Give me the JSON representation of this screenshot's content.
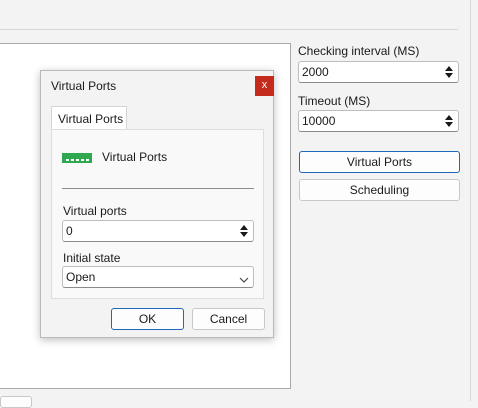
{
  "right_panel": {
    "checking_interval_label": "Checking interval (MS)",
    "checking_interval_value": "2000",
    "timeout_label": "Timeout (MS)",
    "timeout_value": "10000",
    "virtual_ports_button": "Virtual Ports",
    "scheduling_button": "Scheduling"
  },
  "dialog": {
    "title": "Virtual Ports",
    "close_label": "x",
    "tab_label": "Virtual Ports",
    "header_text": "Virtual Ports",
    "virtual_ports_label": "Virtual ports",
    "virtual_ports_value": "0",
    "initial_state_label": "Initial state",
    "initial_state_value": "Open",
    "ok_label": "OK",
    "cancel_label": "Cancel"
  },
  "colors": {
    "close_button": "#c42b1c",
    "primary_border": "#1e68b5",
    "ports_icon": "#2fa84f"
  },
  "icons": [
    "spin-up-icon",
    "spin-down-icon",
    "ports-icon",
    "chevron-down-icon"
  ]
}
